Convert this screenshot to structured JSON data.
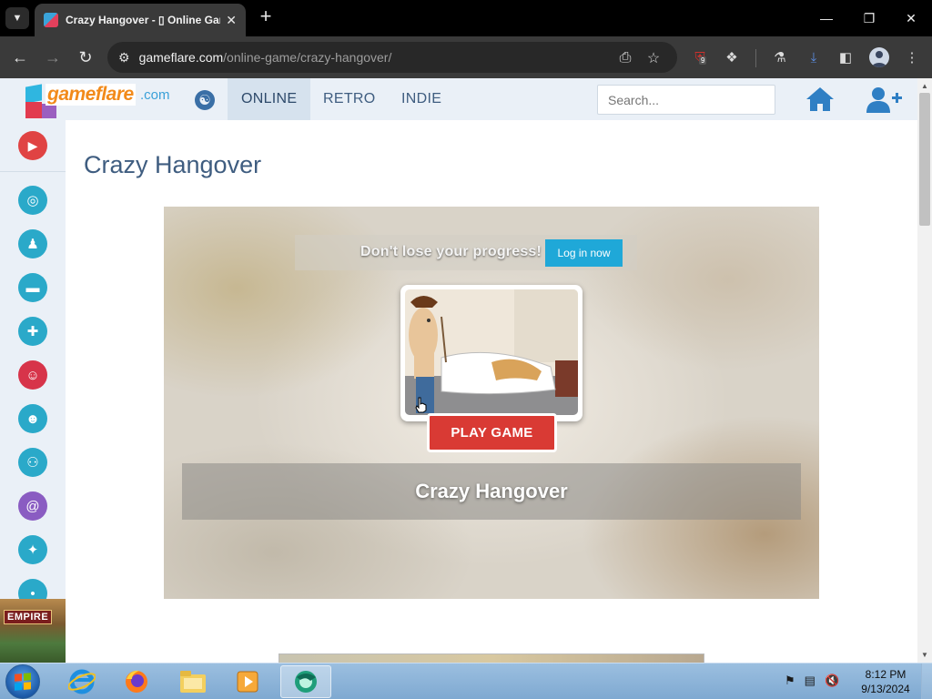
{
  "browser": {
    "tab_title": "Crazy Hangover - ▯ Online Game",
    "url_host": "gameflare.com",
    "url_path": "/online-game/crazy-hangover/",
    "ublock_count": "9"
  },
  "site": {
    "logo_word": "gameflare",
    "logo_suffix": ".com",
    "nav": [
      "ONLINE",
      "RETRO",
      "INDIE"
    ],
    "active_nav": "ONLINE",
    "search_placeholder": "Search..."
  },
  "sidebar": {
    "ad_text": "EMPIRE",
    "categories": [
      {
        "icon": "3d-glasses-icon",
        "color": "#2aa9c9"
      },
      {
        "icon": "penguin-icon",
        "color": "#2aa9c9"
      },
      {
        "icon": "car-icon",
        "color": "#2aa9c9"
      },
      {
        "icon": "gamepad-icon",
        "color": "#2aa9c9"
      },
      {
        "icon": "clown-icon",
        "color": "#d7344a"
      },
      {
        "icon": "monkey-icon",
        "color": "#2aa9c9"
      },
      {
        "icon": "people-icon",
        "color": "#2aa9c9"
      },
      {
        "icon": "snail-icon",
        "color": "#8a5cc2"
      },
      {
        "icon": "puzzle-icon",
        "color": "#2aa9c9"
      },
      {
        "icon": "more-icon",
        "color": "#2aa9c9"
      }
    ]
  },
  "game": {
    "page_title": "Crazy Hangover",
    "login_prompt": "Don't lose your progress!",
    "login_button": "Log in now",
    "play_button": "PLAY GAME",
    "overlay_title": "Crazy Hangover"
  },
  "taskbar": {
    "time": "8:12 PM",
    "date": "9/13/2024"
  },
  "colors": {
    "accent_blue": "#1fa8d8",
    "play_red": "#d93a34",
    "nav_text": "#3f5d80",
    "header_bg": "#eaf0f7"
  }
}
